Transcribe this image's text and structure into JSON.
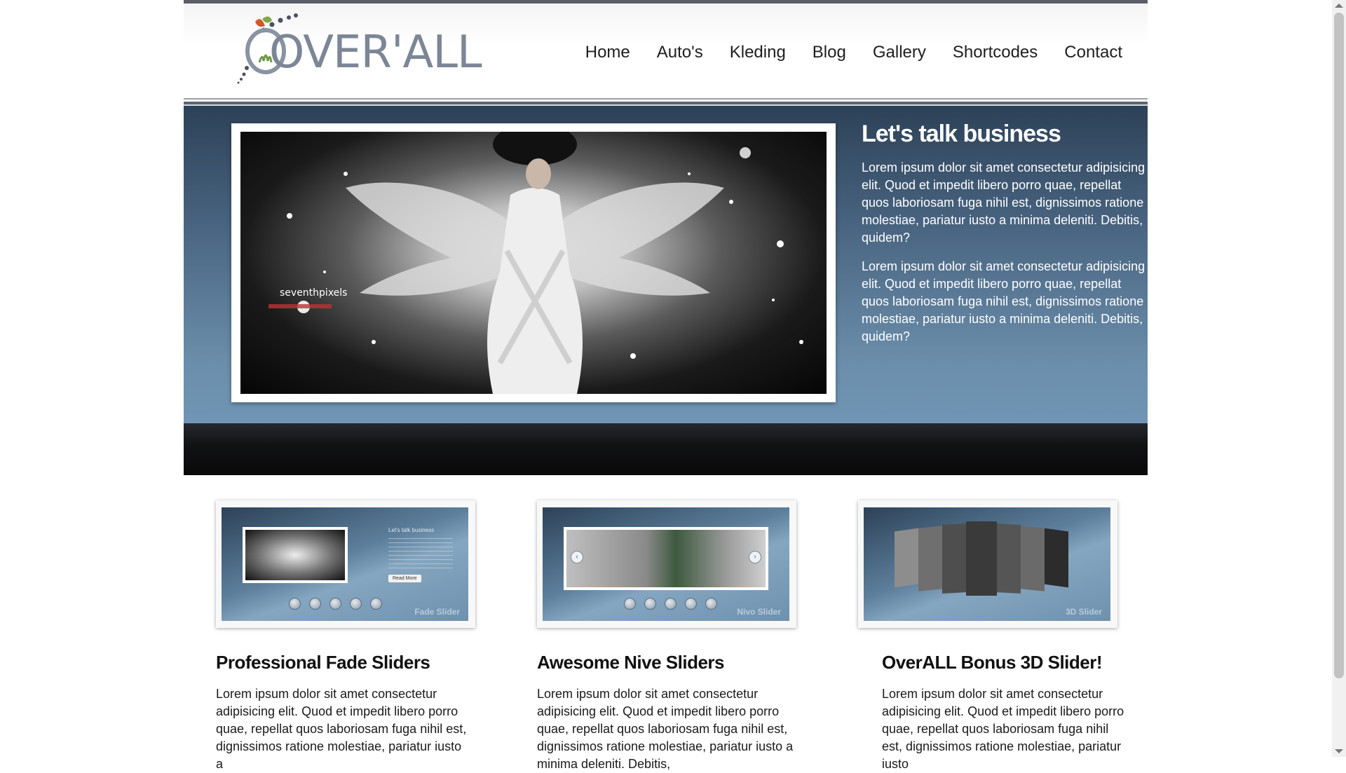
{
  "site": {
    "logo_text": "OVER'ALL"
  },
  "nav": {
    "items": [
      "Home",
      "Auto's",
      "Kleding",
      "Blog",
      "Gallery",
      "Shortcodes",
      "Contact"
    ]
  },
  "hero": {
    "title": "Let's talk business",
    "paragraphs": [
      "Lorem ipsum dolor sit amet consectetur adipisicing elit. Quod et impedit libero porro quae, repellat quos laboriosam fuga nihil est, dignissimos ratione molestiae, pariatur iusto a minima deleniti. Debitis, quidem?",
      "Lorem ipsum dolor sit amet consectetur adipisicing elit. Quod et impedit libero porro quae, repellat quos laboriosam fuga nihil est, dignissimos ratione molestiae, pariatur iusto a minima deleniti. Debitis, quidem?"
    ],
    "image_watermark": "seventhpixels"
  },
  "features": [
    {
      "caption": "Fade Slider",
      "title": "Professional Fade Sliders",
      "text": "Lorem ipsum dolor sit amet consectetur adipisicing elit. Quod et impedit libero porro quae, repellat quos laboriosam fuga nihil est, dignissimos ratione molestiae, pariatur iusto a",
      "preview_heading": "Let's talk business",
      "preview_button": "Read More"
    },
    {
      "caption": "Nivo Slider",
      "title": "Awesome Nive Sliders",
      "text": "Lorem ipsum dolor sit amet consectetur adipisicing elit. Quod et impedit libero porro quae, repellat quos laboriosam fuga nihil est, dignissimos ratione molestiae, pariatur iusto a minima deleniti. Debitis,"
    },
    {
      "caption": "3D Slider",
      "title": "OverALL Bonus 3D Slider!",
      "text": "Lorem ipsum dolor sit amet consectetur adipisicing elit. Quod et impedit libero porro quae, repellat quos laboriosam fuga nihil est, dignissimos ratione molestiae, pariatur iusto"
    }
  ],
  "colors": {
    "hero_top": "#2d4258",
    "hero_bottom": "#7096b5",
    "header_border": "#5a5e68",
    "logo_gray": "#7c8696"
  }
}
